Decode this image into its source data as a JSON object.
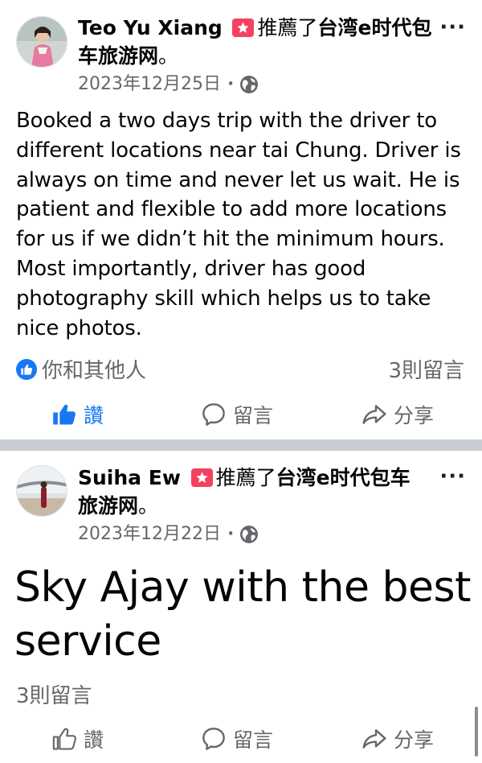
{
  "posts": [
    {
      "author": "Teo Yu Xiang",
      "recommend_text": "推薦了",
      "page": "台湾e时代包车旅游网",
      "period": "。",
      "date": "2023年12月25日",
      "separator": "·",
      "privacy_icon": "globe-icon",
      "body": "Booked a two days trip with the driver to different locations near tai Chung. Driver is always on time and never let us wait. He is patient and flexible to add more locations for us if we didn’t hit the minimum hours. Most importantly, driver has good photography skill which helps us to take nice photos.",
      "reactions_text": "你和其他人",
      "comment_count": "3則留言",
      "actions": {
        "like": "讚",
        "comment": "留言",
        "share": "分享"
      },
      "liked": true
    },
    {
      "author": "Suiha Ew",
      "recommend_text": "推薦了",
      "page": "台湾e时代包车旅游网",
      "period": "。",
      "date": "2023年12月22日",
      "separator": "·",
      "privacy_icon": "globe-icon",
      "body": "Sky Ajay with the best service",
      "comment_count": "3則留言",
      "actions": {
        "like": "讚",
        "comment": "留言",
        "share": "分享"
      },
      "liked": false
    }
  ],
  "colors": {
    "accent": "#1877f2",
    "recommend_badge": "#f3425f",
    "secondary_text": "#65676b",
    "divider": "#c9ccd1"
  }
}
